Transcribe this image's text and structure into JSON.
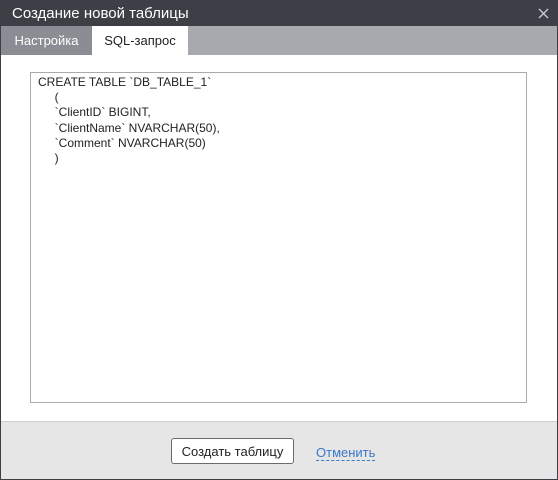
{
  "dialog": {
    "title": "Создание новой таблицы",
    "close_icon": "close-icon"
  },
  "tabs": [
    {
      "label": "Настройка",
      "active": false
    },
    {
      "label": "SQL-запрос",
      "active": true
    }
  ],
  "sql": {
    "lines": [
      "CREATE TABLE `DB_TABLE_1`",
      "     (",
      "     `ClientID` BIGINT,",
      "     `ClientName` NVARCHAR(50),",
      "     `Comment` NVARCHAR(50)",
      "     )"
    ]
  },
  "footer": {
    "create_label": "Создать таблицу",
    "cancel_label": "Отменить"
  },
  "colors": {
    "titlebar": "#3d3f47",
    "tabbar": "#a7a9ae",
    "inactive_tab": "#8a8d93",
    "footer": "#e6e6e6",
    "link": "#3a78c9"
  }
}
